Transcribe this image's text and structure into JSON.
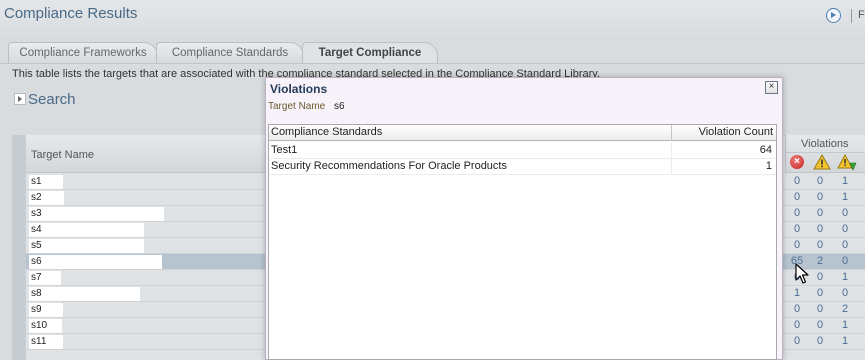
{
  "header": {
    "title": "Compliance Results",
    "truncated_text": "F",
    "play_icon": "play-circle-icon"
  },
  "tabs": [
    {
      "label": "Compliance Frameworks",
      "selected": false
    },
    {
      "label": "Compliance Standards",
      "selected": false
    },
    {
      "label": "Target Compliance",
      "selected": true
    }
  ],
  "description": "This table lists the targets that are associated with the compliance standard selected in the Compliance Standard Library.",
  "search": {
    "label": "Search",
    "expand_icon": "expand-triangle-icon"
  },
  "table": {
    "target_name_header": "Target Name",
    "violations_header": "Violations",
    "violation_icons": [
      "critical-icon",
      "warning-icon",
      "minor-warning-icon"
    ],
    "rows": [
      {
        "name": "s1",
        "critical": "0",
        "warning": "0",
        "minor": "1"
      },
      {
        "name": "s2",
        "critical": "0",
        "warning": "0",
        "minor": "1"
      },
      {
        "name": "s3",
        "critical": "0",
        "warning": "0",
        "minor": "0"
      },
      {
        "name": "s4",
        "critical": "0",
        "warning": "0",
        "minor": "0"
      },
      {
        "name": "s5",
        "critical": "0",
        "warning": "0",
        "minor": "0"
      },
      {
        "name": "s6",
        "critical": "65",
        "warning": "2",
        "minor": "0",
        "selected": true
      },
      {
        "name": "s7",
        "critical": "0",
        "warning": "0",
        "minor": "1"
      },
      {
        "name": "s8",
        "critical": "1",
        "warning": "0",
        "minor": "0"
      },
      {
        "name": "s9",
        "critical": "0",
        "warning": "0",
        "minor": "2"
      },
      {
        "name": "s10",
        "critical": "0",
        "warning": "0",
        "minor": "1"
      },
      {
        "name": "s11",
        "critical": "0",
        "warning": "0",
        "minor": "1"
      }
    ]
  },
  "dialog": {
    "title": "Violations",
    "close_icon": "close-icon",
    "target_name_label": "Target Name",
    "target_name_value": "s6",
    "columns": {
      "standards": "Compliance Standards",
      "count": "Violation Count"
    },
    "rows": [
      {
        "standard": "Test1",
        "count": "64"
      },
      {
        "standard": "Security Recommendations For Oracle Products",
        "count": "1"
      }
    ]
  },
  "colors": {
    "title_blue": "#4b6a86",
    "violation_count_blue": "#4b6f95",
    "critical_red": "#c8231f",
    "warning_yellow": "#f2c52e",
    "selected_row": "#b7c4d0",
    "dialog_background": "#f8f3fa"
  }
}
